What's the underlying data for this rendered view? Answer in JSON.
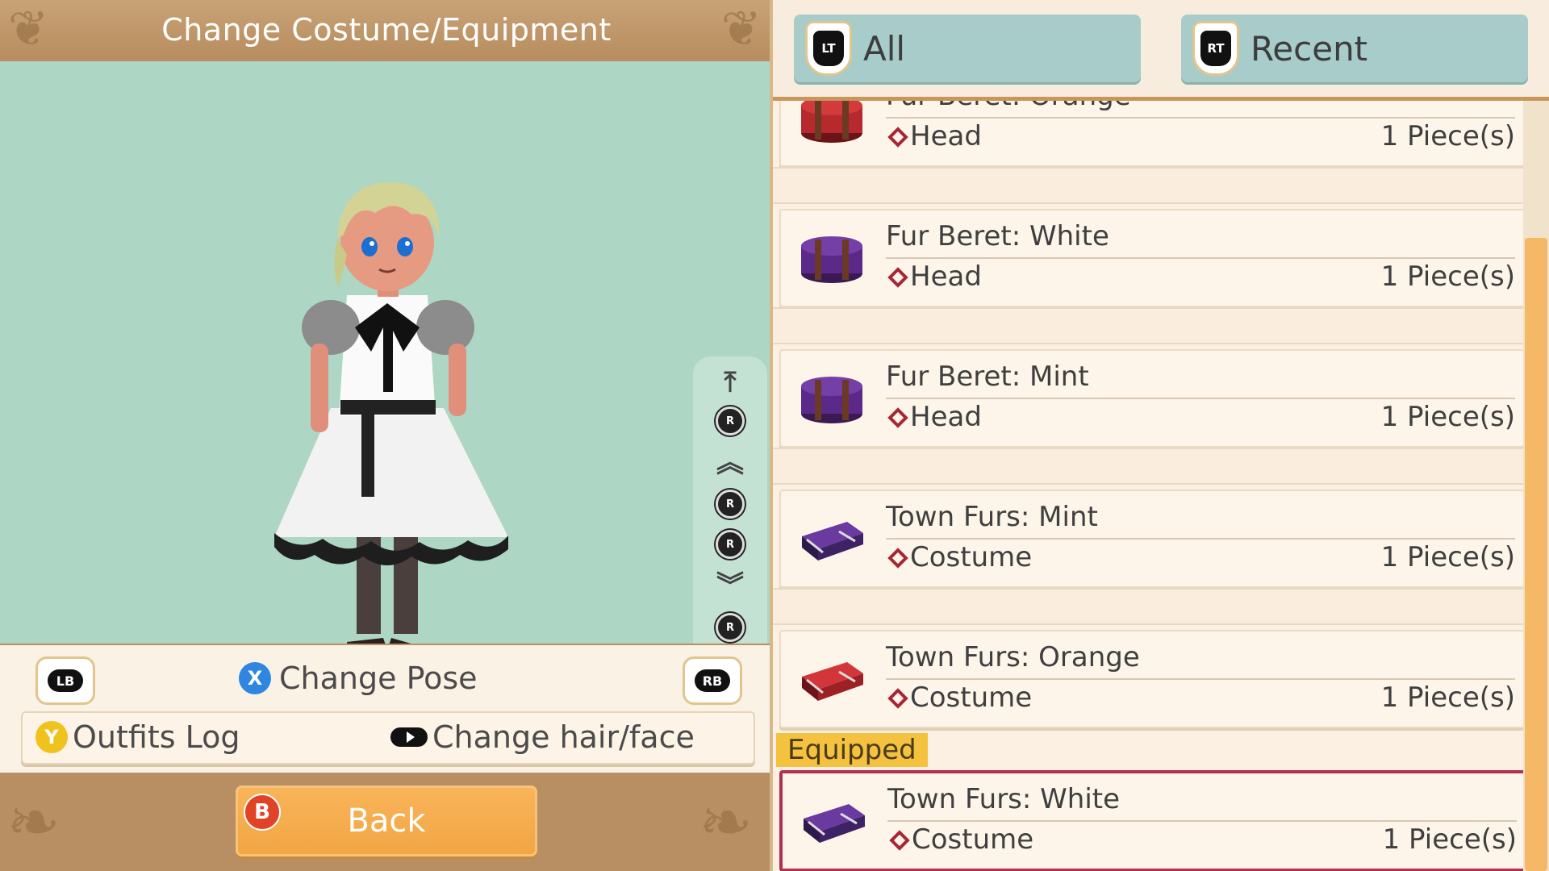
{
  "header": {
    "title": "Change Costume/Equipment"
  },
  "controls": {
    "lb_label": "LB",
    "rb_label": "RB",
    "pose_button": "X",
    "pose_label": "Change Pose",
    "outfits_button": "Y",
    "outfits_label": "Outfits Log",
    "hair_label": "Change hair/face",
    "back_button": "B",
    "back_label": "Back"
  },
  "camera": {
    "r_label": "R"
  },
  "tabs": [
    {
      "trigger": "LT",
      "label": "All"
    },
    {
      "trigger": "RT",
      "label": "Recent"
    }
  ],
  "items": [
    {
      "name": "Fur Beret: Orange",
      "type": "Head",
      "qty": "1 Piece(s)",
      "icon": "red-hatbox-icon"
    },
    {
      "name": "Fur Beret: White",
      "type": "Head",
      "qty": "1 Piece(s)",
      "icon": "purple-hatbox-icon"
    },
    {
      "name": "Fur Beret: Mint",
      "type": "Head",
      "qty": "1 Piece(s)",
      "icon": "purple-hatbox-icon"
    },
    {
      "name": "Town Furs: Mint",
      "type": "Costume",
      "qty": "1 Piece(s)",
      "icon": "purple-suitcase-icon"
    },
    {
      "name": "Town Furs: Orange",
      "type": "Costume",
      "qty": "1 Piece(s)",
      "icon": "red-suitcase-icon"
    },
    {
      "name": "Town Furs: White",
      "type": "Costume",
      "qty": "1 Piece(s)",
      "icon": "purple-suitcase-icon"
    }
  ],
  "equipped_label": "Equipped",
  "colors": {
    "preview_bg": "#aed6c4",
    "tab_bg": "#a8ccca",
    "accent_orange": "#f1a543",
    "equipped_border": "#b03050",
    "equipped_tag": "#f4c23f"
  }
}
